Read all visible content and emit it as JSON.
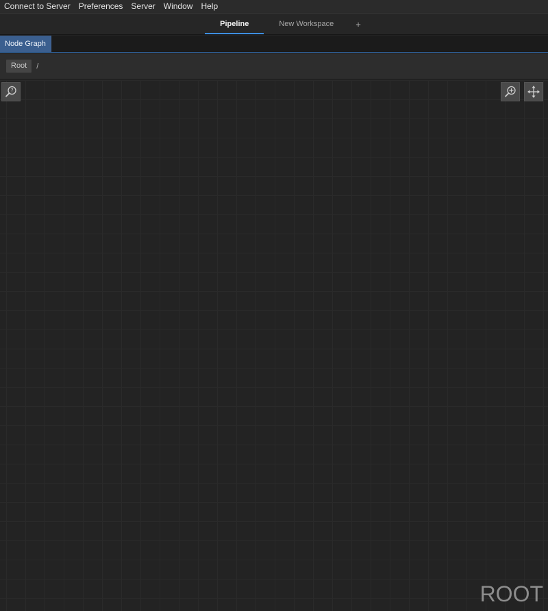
{
  "menubar": {
    "items": [
      "Connect to Server",
      "Preferences",
      "Server",
      "Window",
      "Help"
    ]
  },
  "workspace_tabs": {
    "tabs": [
      {
        "label": "Pipeline",
        "active": true
      },
      {
        "label": "New Workspace",
        "active": false
      }
    ],
    "add_label": "+"
  },
  "panel": {
    "tab_label": "Node Graph"
  },
  "breadcrumb": {
    "root_label": "Root",
    "separator": "/"
  },
  "graph": {
    "watermark": "ROOT",
    "tools": {
      "help_icon": "magnifier-question-icon",
      "zoom_icon": "zoom-in-icon",
      "pan_icon": "move-arrows-icon"
    }
  },
  "colors": {
    "accent": "#3d8ee0",
    "panel_tab": "#3b5f8f",
    "background": "#232323"
  }
}
